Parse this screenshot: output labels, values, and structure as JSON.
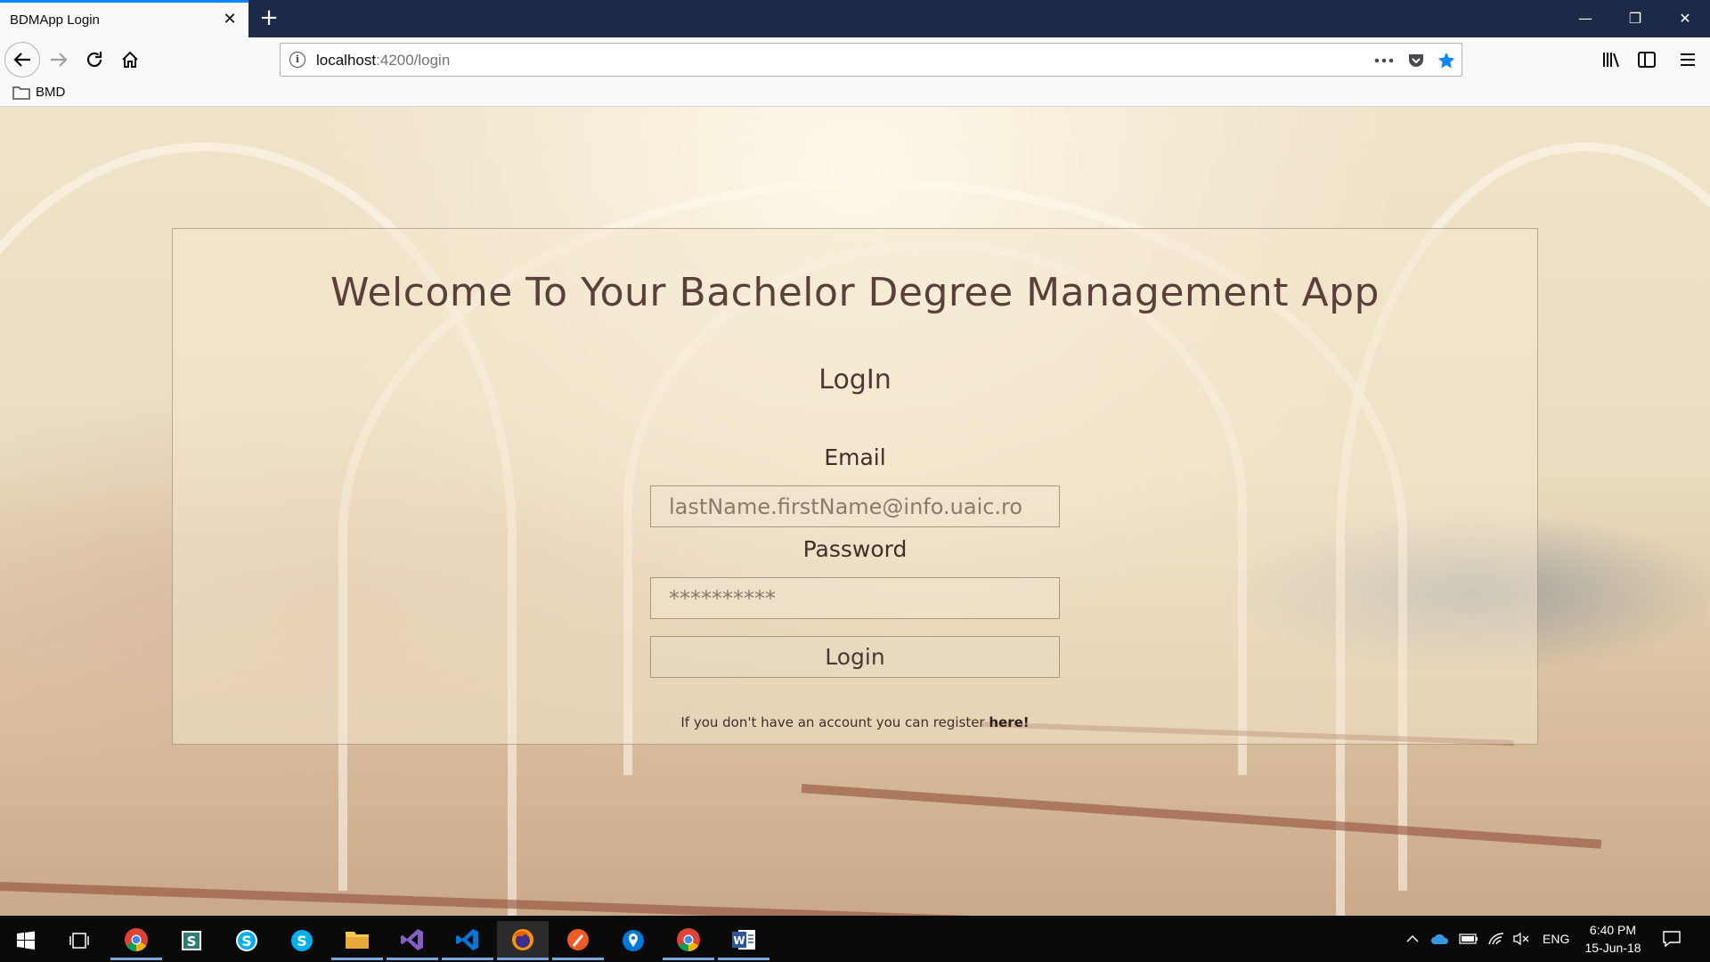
{
  "browser": {
    "tab_title": "BDMApp Login",
    "url_host": "localhost",
    "url_path": ":4200/login",
    "bookmark_folder": "BMD",
    "accent_color": "#0a84ff"
  },
  "page": {
    "welcome_title": "Welcome To Your Bachelor Degree Management App",
    "login_heading": "LogIn",
    "email_label": "Email",
    "email_placeholder": "lastName.firstName@info.uaic.ro",
    "password_label": "Password",
    "password_placeholder": "**********",
    "login_button": "Login",
    "register_text": "If you don't have an account you can register ",
    "register_link": "here!"
  },
  "taskbar": {
    "apps": [
      "windows-start-icon",
      "task-view-icon",
      "chrome-icon",
      "sway-icon",
      "skype-icon",
      "skype-blue-icon",
      "file-explorer-icon",
      "visual-studio-icon",
      "vscode-icon",
      "firefox-icon",
      "postman-icon",
      "maps-icon",
      "chrome-icon",
      "word-icon"
    ],
    "language": "ENG",
    "time": "6:40 PM",
    "date": "15-Jun-18"
  }
}
